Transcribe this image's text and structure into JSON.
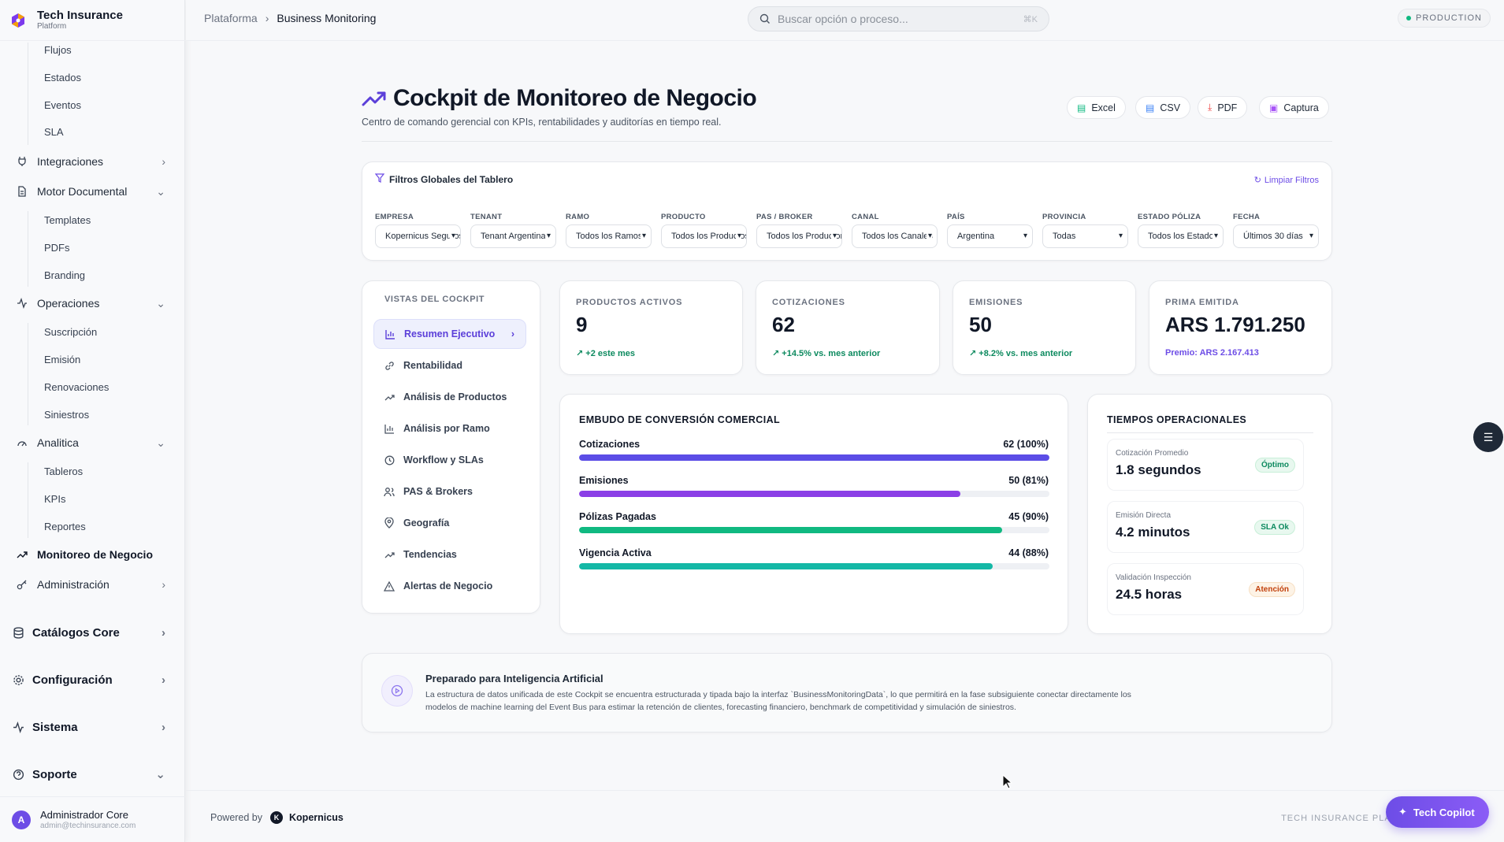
{
  "brand": {
    "name": "Tech Insurance",
    "sub": "Platform"
  },
  "sidebar": {
    "flujos": "Flujos",
    "estados": "Estados",
    "eventos": "Eventos",
    "sla": "SLA",
    "integraciones": "Integraciones",
    "motor_documental": "Motor Documental",
    "templates": "Templates",
    "pdfs": "PDFs",
    "branding": "Branding",
    "operaciones": "Operaciones",
    "suscripcion": "Suscripción",
    "emision": "Emisión",
    "renovaciones": "Renovaciones",
    "siniestros": "Siniestros",
    "analitica": "Analitica",
    "tableros": "Tableros",
    "kpis": "KPIs",
    "reportes": "Reportes",
    "monitoreo": "Monitoreo de Negocio",
    "administracion": "Administración",
    "catalogos": "Catálogos Core",
    "configuracion": "Configuración",
    "sistema": "Sistema",
    "soporte": "Soporte"
  },
  "user": {
    "initial": "A",
    "name": "Administrador Core",
    "email": "admin@techinsurance.com"
  },
  "topbar": {
    "crumb_root": "Plataforma",
    "crumb_current": "Business Monitoring",
    "search_placeholder": "Buscar opción o proceso...",
    "search_kbd": "⌘K",
    "env": "PRODUCTION"
  },
  "header": {
    "title": "Cockpit de Monitoreo de Negocio",
    "subtitle": "Centro de comando gerencial con KPIs, rentabilidades y auditorías en tiempo real.",
    "export": {
      "excel": "Excel",
      "csv": "CSV",
      "pdf": "PDF",
      "captura": "Captura"
    }
  },
  "filters": {
    "title": "Filtros Globales del Tablero",
    "clear": "Limpiar Filtros",
    "items": [
      {
        "label": "EMPRESA",
        "value": "Kopernicus Seguros"
      },
      {
        "label": "TENANT",
        "value": "Tenant Argentina"
      },
      {
        "label": "RAMO",
        "value": "Todos los Ramos"
      },
      {
        "label": "PRODUCTO",
        "value": "Todos los Productos"
      },
      {
        "label": "PAS / BROKER",
        "value": "Todos los Productores"
      },
      {
        "label": "CANAL",
        "value": "Todos los Canales"
      },
      {
        "label": "PAÍS",
        "value": "Argentina"
      },
      {
        "label": "PROVINCIA",
        "value": "Todas"
      },
      {
        "label": "ESTADO PÓLIZA",
        "value": "Todos los Estados"
      },
      {
        "label": "FECHA",
        "value": "Últimos 30 días"
      }
    ]
  },
  "cockpit_nav": {
    "heading": "VISTAS DEL COCKPIT",
    "items": [
      {
        "label": "Resumen Ejecutivo",
        "icon": "bar-chart-icon"
      },
      {
        "label": "Rentabilidad",
        "icon": "link-icon"
      },
      {
        "label": "Análisis de Productos",
        "icon": "trend-icon"
      },
      {
        "label": "Análisis por Ramo",
        "icon": "bar-chart-icon"
      },
      {
        "label": "Workflow y SLAs",
        "icon": "clock-icon"
      },
      {
        "label": "PAS & Brokers",
        "icon": "users-icon"
      },
      {
        "label": "Geografía",
        "icon": "pin-icon"
      },
      {
        "label": "Tendencias",
        "icon": "trend-icon"
      },
      {
        "label": "Alertas de Negocio",
        "icon": "alert-icon"
      }
    ]
  },
  "kpis": [
    {
      "label": "PRODUCTOS ACTIVOS",
      "value": "9",
      "delta": "+2 este mes"
    },
    {
      "label": "COTIZACIONES",
      "value": "62",
      "delta": "+14.5% vs. mes anterior"
    },
    {
      "label": "EMISIONES",
      "value": "50",
      "delta": "+8.2% vs. mes anterior"
    },
    {
      "label": "PRIMA EMITIDA",
      "value": "ARS 1.791.250",
      "delta": "Premio: ARS 2.167.413"
    }
  ],
  "funnel": {
    "title": "EMBUDO DE CONVERSIÓN COMERCIAL",
    "rows": [
      {
        "label": "Cotizaciones",
        "value": "62 (100%)",
        "pct": 100,
        "color": "#5b4de6"
      },
      {
        "label": "Emisiones",
        "value": "50 (81%)",
        "pct": 81,
        "color": "#8b3fe6"
      },
      {
        "label": "Pólizas Pagadas",
        "value": "45 (90%)",
        "pct": 90,
        "color": "#10b981"
      },
      {
        "label": "Vigencia Activa",
        "value": "44 (88%)",
        "pct": 88,
        "color": "#14b8a6"
      }
    ]
  },
  "times": {
    "title": "TIEMPOS OPERACIONALES",
    "items": [
      {
        "label": "Cotización Promedio",
        "value": "1.8 segundos",
        "badge": "Óptimo"
      },
      {
        "label": "Emisión Directa",
        "value": "4.2 minutos",
        "badge": "SLA Ok"
      },
      {
        "label": "Validación Inspección",
        "value": "24.5 horas",
        "badge": "Atención"
      }
    ]
  },
  "ai": {
    "title": "Preparado para Inteligencia Artificial",
    "text": "La estructura de datos unificada de este Cockpit se encuentra estructurada y tipada bajo la interfaz `BusinessMonitoringData`, lo que permitirá en la fase subsiguiente conectar directamente los modelos de machine learning del Event Bus para estimar la retención de clientes, forecasting financiero, benchmark de competitividad y simulación de siniestros."
  },
  "footer": {
    "powered": "Powered by",
    "logo_letter": "K",
    "company": "Kopernicus",
    "right": "TECH INSURANCE PLATFORM"
  },
  "copilot": {
    "label": "Tech Copilot"
  }
}
